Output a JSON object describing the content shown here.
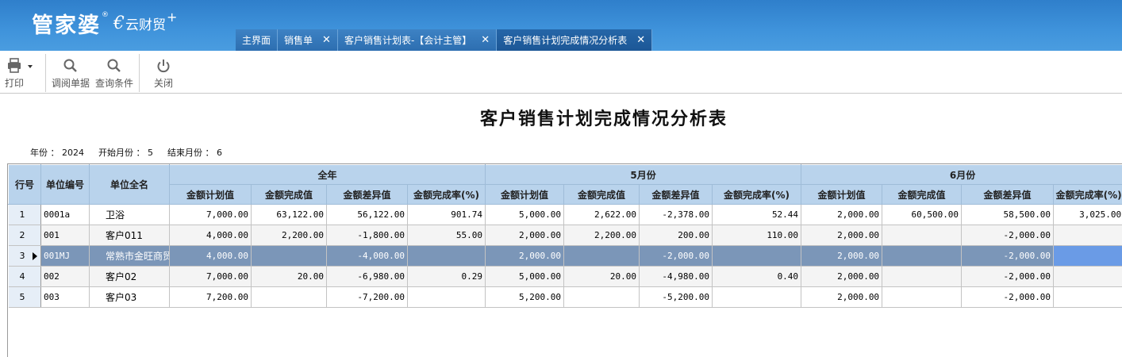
{
  "app": {
    "logo_main": "管家婆",
    "logo_reg": "®",
    "logo_sub": "云财贸",
    "logo_plus": "+"
  },
  "tabs": [
    {
      "label": "主界面",
      "closable": false,
      "active": false
    },
    {
      "label": "销售单",
      "closable": true,
      "active": false
    },
    {
      "label": "客户销售计划表-【会计主管】",
      "closable": true,
      "active": false
    },
    {
      "label": "客户销售计划完成情况分析表",
      "closable": true,
      "active": true
    }
  ],
  "tab_close_glyph": "✕",
  "toolbar": {
    "print_label": "打印",
    "print_icon": "printer-icon",
    "view_label": "调阅单据",
    "view_icon": "search-icon",
    "query_label": "查询条件",
    "query_icon": "search-icon",
    "close_label": "关闭",
    "close_icon": "power-icon"
  },
  "report": {
    "title": "客户销售计划完成情况分析表",
    "year_label": "年份 ：",
    "year": "2024",
    "start_label": "开始月份 ：",
    "start_month": "5",
    "end_label": "结束月份 ：",
    "end_month": "6"
  },
  "table": {
    "col_row": "行号",
    "col_code": "单位编号",
    "col_name": "单位全名",
    "groups": [
      "全年",
      "5月份",
      "6月份"
    ],
    "sub": [
      "金额计划值",
      "金额完成值",
      "金额差异值",
      "金额完成率(%)"
    ],
    "rows": [
      {
        "n": "1",
        "code": "0001a",
        "name": "卫浴",
        "vals": [
          "7,000.00",
          "63,122.00",
          "56,122.00",
          "901.74",
          "5,000.00",
          "2,622.00",
          "-2,378.00",
          "52.44",
          "2,000.00",
          "60,500.00",
          "58,500.00",
          "3,025.00"
        ]
      },
      {
        "n": "2",
        "code": "001",
        "name": "客户011",
        "vals": [
          "4,000.00",
          "2,200.00",
          "-1,800.00",
          "55.00",
          "2,000.00",
          "2,200.00",
          "200.00",
          "110.00",
          "2,000.00",
          "",
          "-2,000.00",
          ""
        ]
      },
      {
        "n": "3",
        "code": "001MJ",
        "name": "常熟市金旺商贸",
        "vals": [
          "4,000.00",
          "",
          "-4,000.00",
          "",
          "2,000.00",
          "",
          "-2,000.00",
          "",
          "2,000.00",
          "",
          "-2,000.00",
          ""
        ]
      },
      {
        "n": "4",
        "code": "002",
        "name": "客户02",
        "vals": [
          "7,000.00",
          "20.00",
          "-6,980.00",
          "0.29",
          "5,000.00",
          "20.00",
          "-4,980.00",
          "0.40",
          "2,000.00",
          "",
          "-2,000.00",
          ""
        ]
      },
      {
        "n": "5",
        "code": "003",
        "name": "客户03",
        "vals": [
          "7,200.00",
          "",
          "-7,200.00",
          "",
          "5,200.00",
          "",
          "-5,200.00",
          "",
          "2,000.00",
          "",
          "-2,000.00",
          ""
        ]
      }
    ],
    "selected_row": 2
  },
  "colors": {
    "header": "#3f93db",
    "tab_active": "#1c5796",
    "grid_header": "#b9d3ec",
    "selected_row": "#7b96b8",
    "current_cell": "#6a9be6"
  }
}
